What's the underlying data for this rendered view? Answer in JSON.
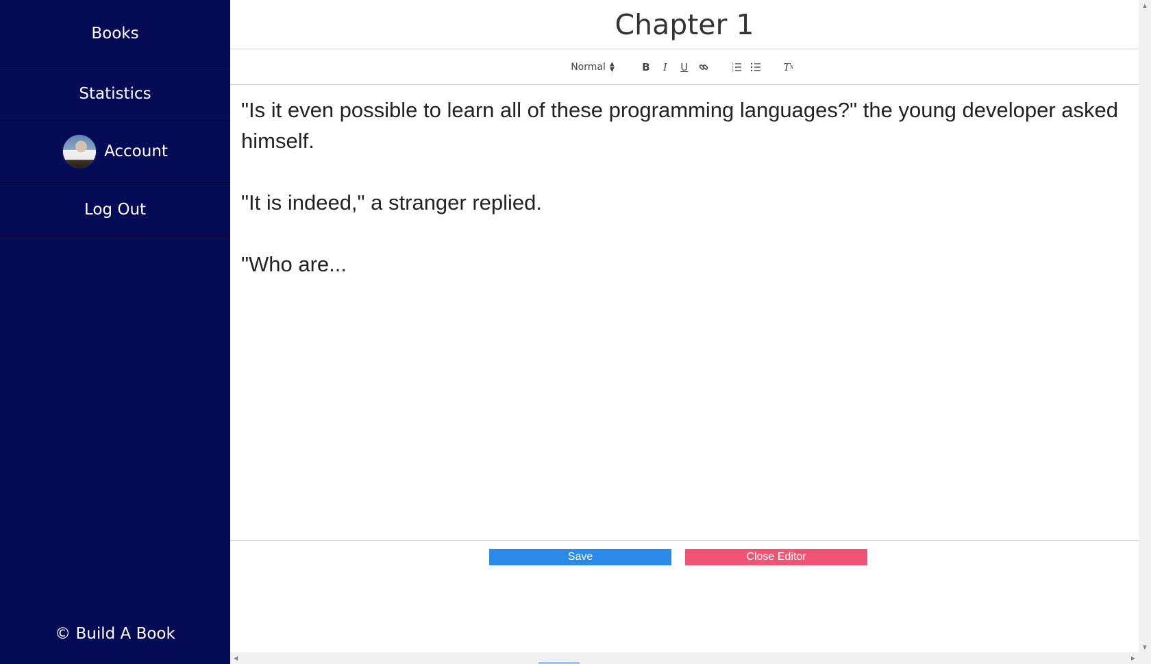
{
  "sidebar": {
    "items": [
      {
        "label": "Books"
      },
      {
        "label": "Statistics"
      },
      {
        "label": "Account"
      },
      {
        "label": "Log Out"
      }
    ],
    "footer": "© Build A Book",
    "background": "#060b55"
  },
  "main": {
    "chapter_title": "Chapter 1",
    "toolbar": {
      "format_value": "Normal",
      "buttons": [
        {
          "name": "bold-icon",
          "glyph": "B"
        },
        {
          "name": "italic-icon",
          "glyph": "I"
        },
        {
          "name": "underline-icon",
          "glyph": "U"
        },
        {
          "name": "link-icon",
          "glyph": "link"
        },
        {
          "name": "ordered-list-icon",
          "glyph": "ordered-list"
        },
        {
          "name": "bullet-list-icon",
          "glyph": "bullet-list"
        },
        {
          "name": "clear-format-icon",
          "glyph": "Tx"
        }
      ]
    },
    "editor": {
      "paragraphs": [
        "\"Is it even possible to learn all of these programming languages?\" the young developer asked himself.",
        "\"It is indeed,\" a stranger replied.",
        "\"Who are..."
      ]
    },
    "actions": {
      "save_label": "Save",
      "close_label": "Close Editor",
      "save_color": "#2b8ae8",
      "close_color": "#ef5474"
    }
  }
}
